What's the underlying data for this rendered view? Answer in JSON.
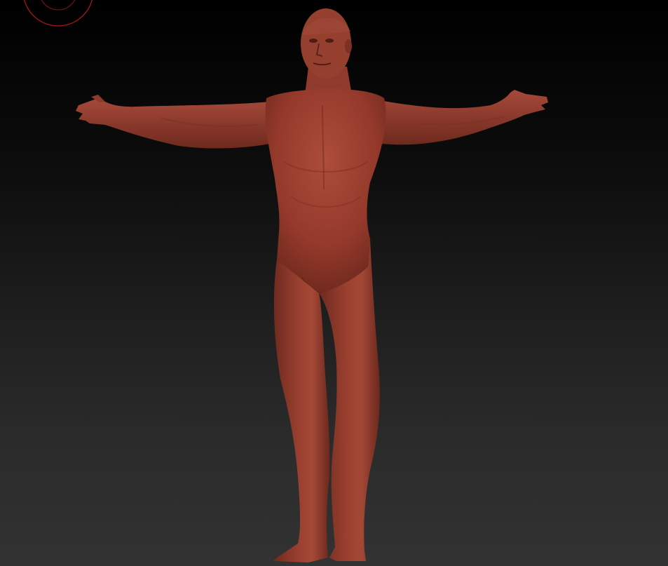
{
  "viewport": {
    "background_top": "#000000",
    "background_bottom": "#323232",
    "gizmo_color": "#b0161b",
    "model_color": "#8c3a2b",
    "model_highlight": "#b55340",
    "model_shadow": "#5a2219",
    "model_name": "human-figure-t-pose"
  }
}
